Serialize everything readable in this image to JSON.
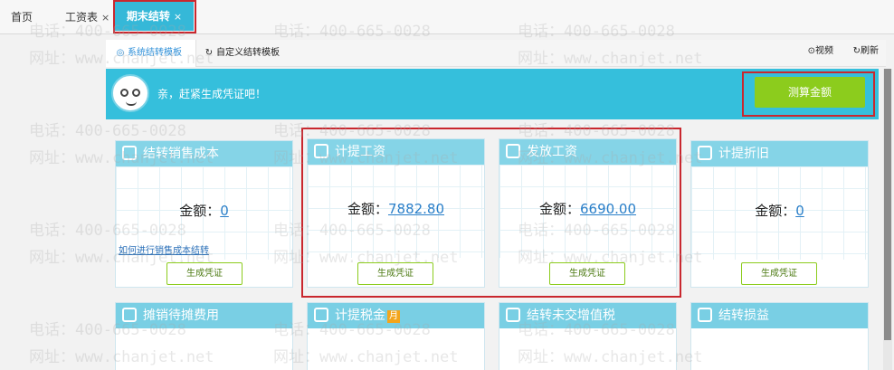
{
  "top_tabs": [
    {
      "label": "首页",
      "close": ""
    },
    {
      "label": "工资表",
      "close": "×"
    },
    {
      "label": "期末结转",
      "close": "×"
    }
  ],
  "sub_tabs": [
    {
      "label": "系统结转模板",
      "icon": "template-icon"
    },
    {
      "label": "自定义结转模板",
      "icon": "custom-template-icon"
    }
  ],
  "sub_actions": [
    {
      "label": "视频",
      "icon": "play-icon"
    },
    {
      "label": "刷新",
      "icon": "refresh-icon"
    }
  ],
  "banner": {
    "text": "亲，赶紧生成凭证吧！",
    "calc_button": "测算金额"
  },
  "amount_label": "金额：",
  "cards": [
    {
      "title": "结转销售成本",
      "amount": "0",
      "link": "如何进行销售成本结转",
      "button": "生成凭证"
    },
    {
      "title": "计提工资",
      "amount": "7882.80",
      "button": "生成凭证"
    },
    {
      "title": "发放工资",
      "amount": "6690.00",
      "button": "生成凭证"
    },
    {
      "title": "计提折旧",
      "amount": "0",
      "button": "生成凭证"
    }
  ],
  "bottom_cards": [
    {
      "title": "摊销待摊费用"
    },
    {
      "title": "计提税金",
      "badge": "月"
    },
    {
      "title": "结转未交增值税"
    },
    {
      "title": "结转损益"
    }
  ],
  "watermark": {
    "phone": "电话：400-665-0028",
    "site": "网址：www.chanjet.net"
  },
  "colors": {
    "accent": "#35bfdc",
    "card_header": "#85d4e7",
    "button_green": "#8ccc1d",
    "highlight_red": "#c9272e",
    "link_blue": "#2a7fc9"
  }
}
